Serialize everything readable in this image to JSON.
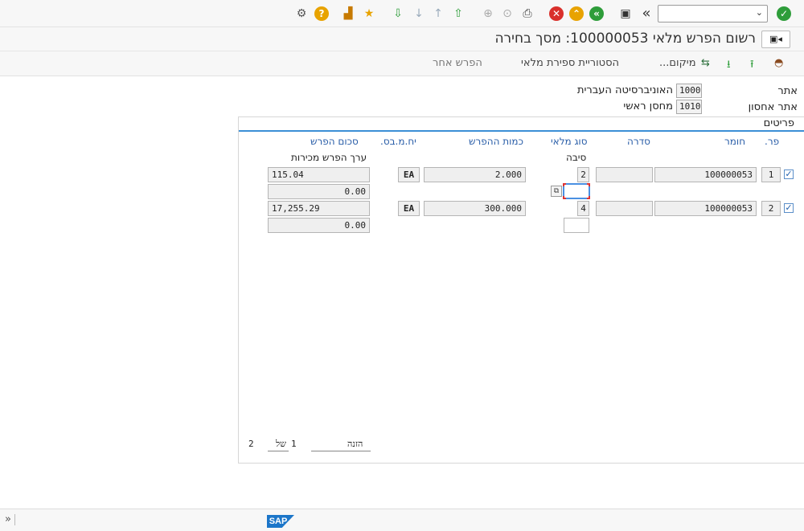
{
  "toolbar": {
    "command_value": "",
    "icons": [
      "enter-icon",
      "command-dropdown-icon",
      "collapse-icon",
      "save-icon",
      "back-icon",
      "exit-icon",
      "cancel-icon",
      "print-icon",
      "find-icon",
      "find-next-icon",
      "first-page-icon",
      "previous-page-icon",
      "next-page-icon",
      "last-page-icon",
      "create-session-icon",
      "shortcut-icon",
      "help-icon",
      "customize-icon"
    ],
    "colors": {
      "enter": "#2e9d3a",
      "back": "#2e9d3a",
      "exit": "#e8a300",
      "cancel": "#d9302b",
      "help": "#e8a300"
    }
  },
  "title": {
    "text": "רשום הפרש מלאי 100000053: מסך בחירה"
  },
  "app_toolbar": {
    "location_label": "מיקום...",
    "history_label": "הסטוריית ספירת מלאי",
    "other_diff_label": "הפרש אחר"
  },
  "header": {
    "plant_label": "אתר",
    "plant_code": "1000",
    "plant_name": "האוניברסיטה העברית",
    "storage_label": "אתר אחסון",
    "storage_code": "1010",
    "storage_name": "מחסן ראשי"
  },
  "items": {
    "group_title": "פריטים",
    "columns": {
      "item": "פר.",
      "material": "חומר",
      "batch": "סדרה",
      "stock_type": "סוג מלאי",
      "diff_qty": "כמות ההפרש",
      "base_unit": "יח.מ.בס.",
      "diff_amount": "סכום הפרש"
    },
    "sub_labels": {
      "reason": "סיבה",
      "sales_value_diff": "ערך הפרש מכירות"
    },
    "rows": [
      {
        "selected": true,
        "item": "1",
        "material": "100000053",
        "batch": "",
        "stock_type": "2",
        "reason": "",
        "diff_qty": "2.000",
        "unit": "EA",
        "diff_amount": "115.04",
        "sales_value": "0.00"
      },
      {
        "selected": true,
        "item": "2",
        "material": "100000053",
        "batch": "",
        "stock_type": "4",
        "reason": "",
        "diff_qty": "300.000",
        "unit": "EA",
        "diff_amount": "17,255.29",
        "sales_value": "0.00"
      }
    ],
    "pager": {
      "entry_label": "הזנה",
      "current": "1",
      "of_label": "של",
      "total": "2"
    }
  },
  "status": {
    "logo_text": "SAP",
    "expand_glyph": "»"
  }
}
